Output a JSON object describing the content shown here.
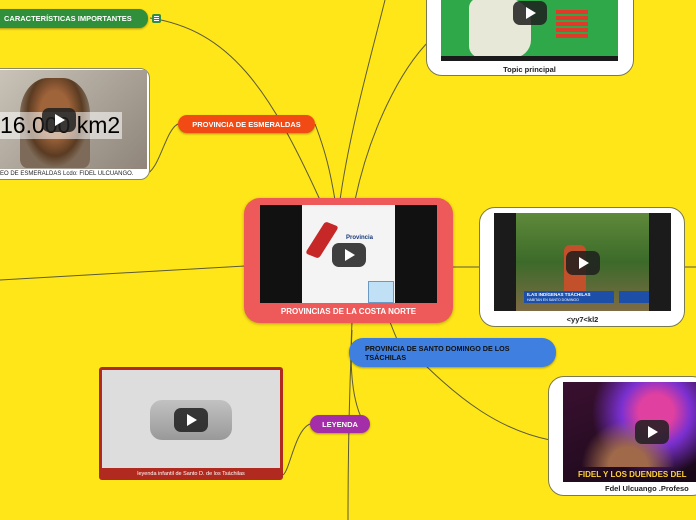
{
  "colors": {
    "canvas": "#FFE619",
    "link": "#5a5a3a",
    "green_node": "#2f8f3a",
    "orange_node": "#F24A14",
    "central_frame": "#EE5A5A",
    "blue_node": "#3F7FE0",
    "purple_node": "#A42DA8"
  },
  "nodes": {
    "caracteristicas": {
      "label": "CARACTERÍSTICAS IMPORTANTES",
      "note_icon": "note-icon"
    },
    "esmeraldas": {
      "label": "PROVINCIA DE ESMERALDAS"
    },
    "central": {
      "label": "PROVINCIAS DE LA COSTA NORTE",
      "map_label": "Provincia"
    },
    "santo_domingo": {
      "label": "PROVINCIA DE SANTO DOMINGO DE LOS TSÁCHILAS"
    },
    "leyenda": {
      "label": "LEYENDA"
    }
  },
  "media": {
    "esmeraldas_video": {
      "overlay_text": "16.000 km2",
      "caption": "EO DE ESMERALDAS Lcdo: FIDEL ULCUANGO."
    },
    "topic_principal": {
      "caption": "Topic principal"
    },
    "tsachilas_video": {
      "caption": "<yy7<kl2",
      "banner": "ILAS INDÍGENAS TSÁCHILAS",
      "banner_sub": "HABITAN EN SANTO DOMINGO"
    },
    "leyenda_video": {
      "caption": "leyenda infantil de Santo D. de los Tsáchilas"
    },
    "fidel_video": {
      "caption": "Fdel Ulcuango .Profeso",
      "overlay_text": "FIDEL Y LOS DUENDES DEL"
    }
  }
}
